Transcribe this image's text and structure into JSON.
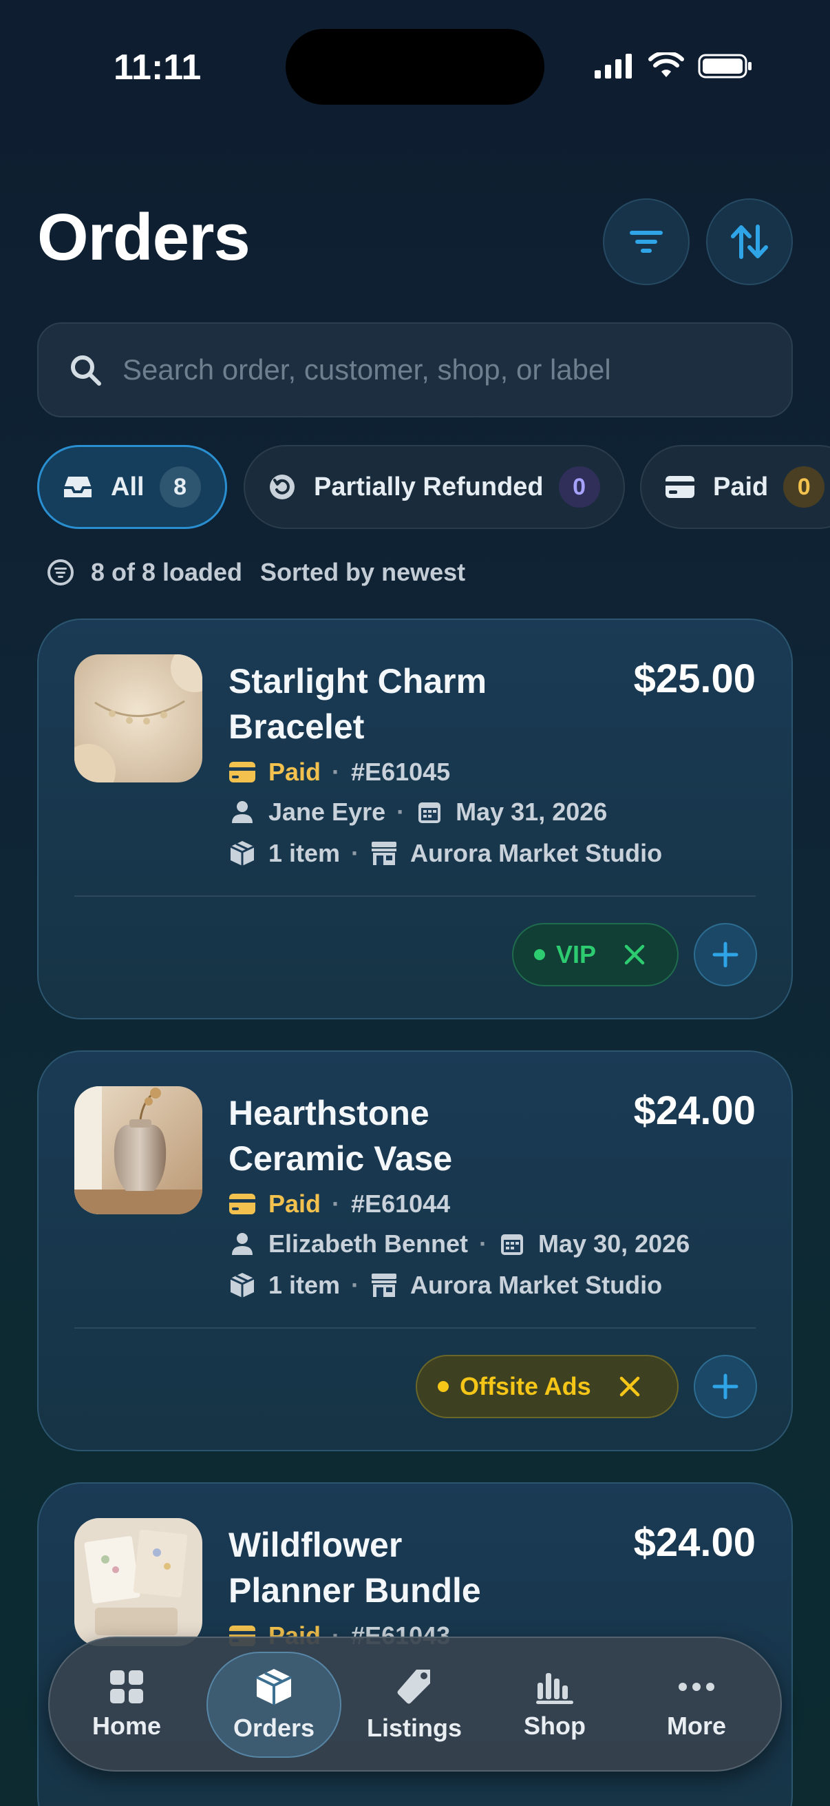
{
  "status_bar": {
    "time": "11:11"
  },
  "header": {
    "title": "Orders"
  },
  "search": {
    "placeholder": "Search order, customer, shop, or label"
  },
  "chips": [
    {
      "label": "All",
      "count": "8",
      "active": true
    },
    {
      "label": "Partially Refunded",
      "count": "0",
      "active": false
    },
    {
      "label": "Paid",
      "count": "0",
      "active": false
    }
  ],
  "meta": {
    "loaded": "8 of 8 loaded",
    "sorted": "Sorted by newest"
  },
  "orders": [
    {
      "title": "Starlight Charm Bracelet",
      "price": "$25.00",
      "status": "Paid",
      "order_id": "#E61045",
      "customer": "Jane Eyre",
      "date": "May 31, 2026",
      "items": "1 item",
      "shop": "Aurora Market Studio",
      "tag": {
        "label": "VIP",
        "color": "#2ecc71"
      }
    },
    {
      "title": "Hearthstone Ceramic Vase",
      "price": "$24.00",
      "status": "Paid",
      "order_id": "#E61044",
      "customer": "Elizabeth Bennet",
      "date": "May 30, 2026",
      "items": "1 item",
      "shop": "Aurora Market Studio",
      "tag": {
        "label": "Offsite Ads",
        "color": "#f5c518"
      }
    },
    {
      "title": "Wildflower Planner Bundle",
      "price": "$24.00",
      "status": "Paid",
      "order_id": "#E61043"
    }
  ],
  "tabbar": [
    {
      "label": "Home",
      "icon": "grid-icon"
    },
    {
      "label": "Orders",
      "icon": "box-icon",
      "active": true
    },
    {
      "label": "Listings",
      "icon": "tag-icon"
    },
    {
      "label": "Shop",
      "icon": "bar-chart-icon"
    },
    {
      "label": "More",
      "icon": "more-icon"
    }
  ],
  "colors": {
    "accent": "#2fa5e8",
    "paid": "#f2c14e"
  }
}
